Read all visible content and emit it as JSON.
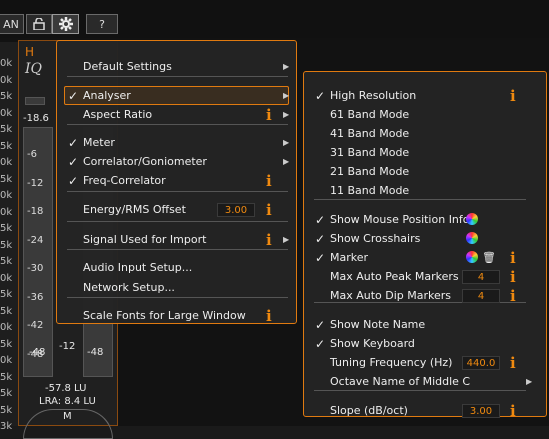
{
  "topbar": {
    "left_label": "AN",
    "help_label": "?"
  },
  "ruler": {
    "labels": [
      "0k",
      "0k",
      "5k",
      "0k",
      "5k",
      "5k",
      "0k",
      "5k",
      "0k",
      "0k",
      "5k",
      "5k",
      "5k",
      "0k",
      "5k",
      "5k",
      "0k",
      "5k",
      "0k",
      "5k",
      "5k",
      "5k",
      "3k"
    ]
  },
  "panel": {
    "tab_h": "H",
    "logo": "IQ",
    "top_value": "-18.6",
    "ticks": [
      "-6",
      "-12",
      "-18",
      "-24",
      "-30",
      "-36",
      "-42",
      "-48"
    ],
    "left_value": "-48",
    "mid_value": "-12",
    "right_value": "-48",
    "lu_value": "-57.8 LU",
    "lra_value": "LRA: 8.4 LU",
    "bottom_m": "M"
  },
  "main_menu": {
    "items": [
      {
        "label": "Default Settings",
        "checked": false,
        "arrow": true,
        "info": false
      },
      {
        "label": "Analyser",
        "checked": true,
        "arrow": true,
        "info": false
      },
      {
        "label": "Aspect Ratio",
        "checked": false,
        "arrow": true,
        "info": true
      },
      {
        "label": "Meter",
        "checked": true,
        "arrow": true,
        "info": false
      },
      {
        "label": "Correlator/Goniometer",
        "checked": true,
        "arrow": true,
        "info": false
      },
      {
        "label": "Freq-Correlator",
        "checked": true,
        "arrow": false,
        "info": true
      },
      {
        "label": "Energy/RMS Offset",
        "checked": false,
        "arrow": false,
        "info": true,
        "value": "3.00"
      },
      {
        "label": "Signal Used for Import",
        "checked": false,
        "arrow": true,
        "info": true
      },
      {
        "label": "Audio Input Setup...",
        "checked": false,
        "arrow": false,
        "info": false
      },
      {
        "label": "Network Setup...",
        "checked": false,
        "arrow": false,
        "info": false
      },
      {
        "label": "Scale Fonts for Large Window",
        "checked": false,
        "arrow": false,
        "info": true
      }
    ]
  },
  "sub_menu": {
    "items": [
      {
        "label": "High Resolution",
        "checked": true,
        "info": true
      },
      {
        "label": "61 Band Mode",
        "checked": false
      },
      {
        "label": "41 Band Mode",
        "checked": false
      },
      {
        "label": "31 Band Mode",
        "checked": false
      },
      {
        "label": "21 Band Mode",
        "checked": false
      },
      {
        "label": "11 Band Mode",
        "checked": false
      },
      {
        "label": "Show Mouse Position Info",
        "checked": true,
        "color_icon": true
      },
      {
        "label": "Show Crosshairs",
        "checked": true,
        "color_icon": true
      },
      {
        "label": "Marker",
        "checked": true,
        "color_icon": true,
        "trash": true,
        "info": true
      },
      {
        "label": "Max Auto Peak Markers",
        "checked": false,
        "value": "4",
        "info": true
      },
      {
        "label": "Max Auto Dip Markers",
        "checked": false,
        "value": "4",
        "info": true
      },
      {
        "label": "Show Note Name",
        "checked": true
      },
      {
        "label": "Show Keyboard",
        "checked": true
      },
      {
        "label": "Tuning Frequency (Hz)",
        "checked": false,
        "value": "440.0",
        "info": true
      },
      {
        "label": "Octave Name of Middle C",
        "checked": false,
        "arrow": true
      },
      {
        "label": "Slope (dB/oct)",
        "checked": false,
        "value": "3.00",
        "info": true
      }
    ]
  },
  "glyphs": {
    "check": "✓",
    "arrow": "▶",
    "info": "i",
    "trash": "🗑"
  },
  "colors": {
    "accent": "#e07a10",
    "info": "#f08a10",
    "menu_bg": "#242424"
  }
}
